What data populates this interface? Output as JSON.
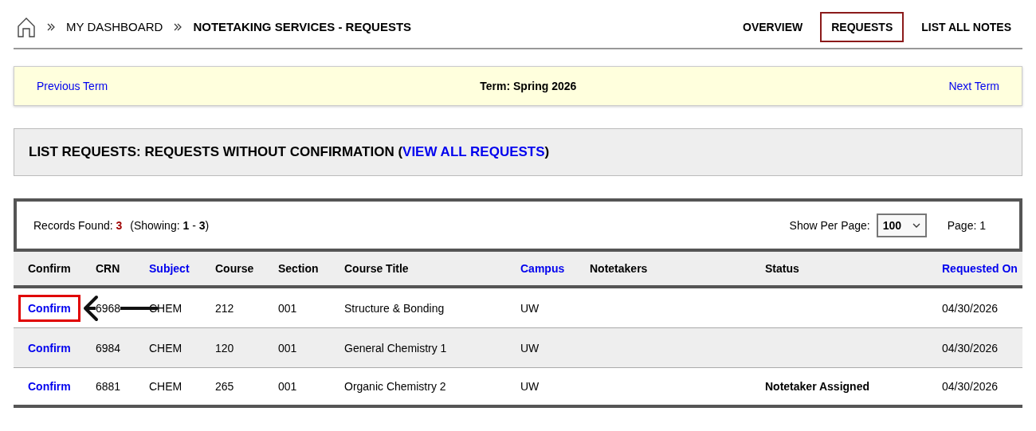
{
  "breadcrumb": [
    {
      "label": "MY DASHBOARD",
      "current": false
    },
    {
      "label": "NOTETAKING SERVICES - REQUESTS",
      "current": true
    }
  ],
  "nav_tabs": [
    {
      "label": "OVERVIEW",
      "selected": false
    },
    {
      "label": "REQUESTS",
      "selected": true
    },
    {
      "label": "LIST ALL NOTES",
      "selected": false
    }
  ],
  "term_bar": {
    "previous": "Previous Term",
    "term": "Term: Spring 2026",
    "next": "Next Term"
  },
  "list_heading": {
    "title": "LIST REQUESTS: REQUESTS WITHOUT CONFIRMATION (",
    "link": "VIEW ALL REQUESTS",
    "close": ")"
  },
  "records": {
    "label": "Records Found:",
    "count": "3",
    "showing": "(Showing: **1** - **3**)",
    "per_page_label": "Show Per Page:",
    "per_page": "100",
    "page": "Page: 1"
  },
  "table": {
    "columns": [
      {
        "label": "Confirm",
        "sortable": false
      },
      {
        "label": "CRN",
        "sortable": false
      },
      {
        "label": "Subject",
        "sortable": true
      },
      {
        "label": "Course",
        "sortable": false
      },
      {
        "label": "Section",
        "sortable": false
      },
      {
        "label": "Course Title",
        "sortable": false
      },
      {
        "label": "Campus",
        "sortable": true
      },
      {
        "label": "Notetakers",
        "sortable": false
      },
      {
        "label": "Status",
        "sortable": false
      },
      {
        "label": "Requested On",
        "sortable": true
      }
    ],
    "rows": [
      {
        "highlighted": true,
        "cells": [
          "Confirm",
          "6968",
          "CHEM",
          "212",
          "001",
          "Structure & Bonding",
          "UW",
          "",
          "",
          "04/30/2026"
        ]
      },
      {
        "highlighted": false,
        "cells": [
          "Confirm",
          "6984",
          "CHEM",
          "120",
          "001",
          "General Chemistry 1",
          "UW",
          "",
          "",
          "04/30/2026"
        ]
      },
      {
        "highlighted": false,
        "cells": [
          "Confirm",
          "6881",
          "CHEM",
          "265",
          "001",
          "Organic Chemistry 2",
          "UW",
          "",
          "Notetaker Assigned",
          "04/30/2026"
        ]
      }
    ]
  }
}
